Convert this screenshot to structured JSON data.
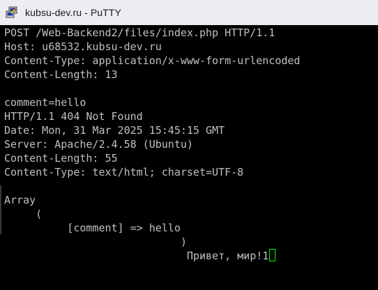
{
  "window": {
    "title": "kubsu-dev.ru - PuTTY",
    "icon": "putty-icon"
  },
  "terminal": {
    "lines": [
      "POST /Web-Backend2/files/index.php HTTP/1.1",
      "Host: u68532.kubsu-dev.ru",
      "Content-Type: application/x-www-form-urlencoded",
      "Content-Length: 13",
      "",
      "comment=hello",
      "HTTP/1.1 404 Not Found",
      "Date: Mon, 31 Mar 2025 15:45:15 GMT",
      "Server: Apache/2.4.58 (Ubuntu)",
      "Content-Length: 55",
      "Content-Type: text/html; charset=UTF-8",
      "",
      "Array",
      "     (",
      "          [comment] => hello",
      "                            )",
      "                             Привет, мир!1"
    ],
    "cursor_color": "#00ff00",
    "text_color": "#c0c0c0",
    "background": "#000000"
  }
}
